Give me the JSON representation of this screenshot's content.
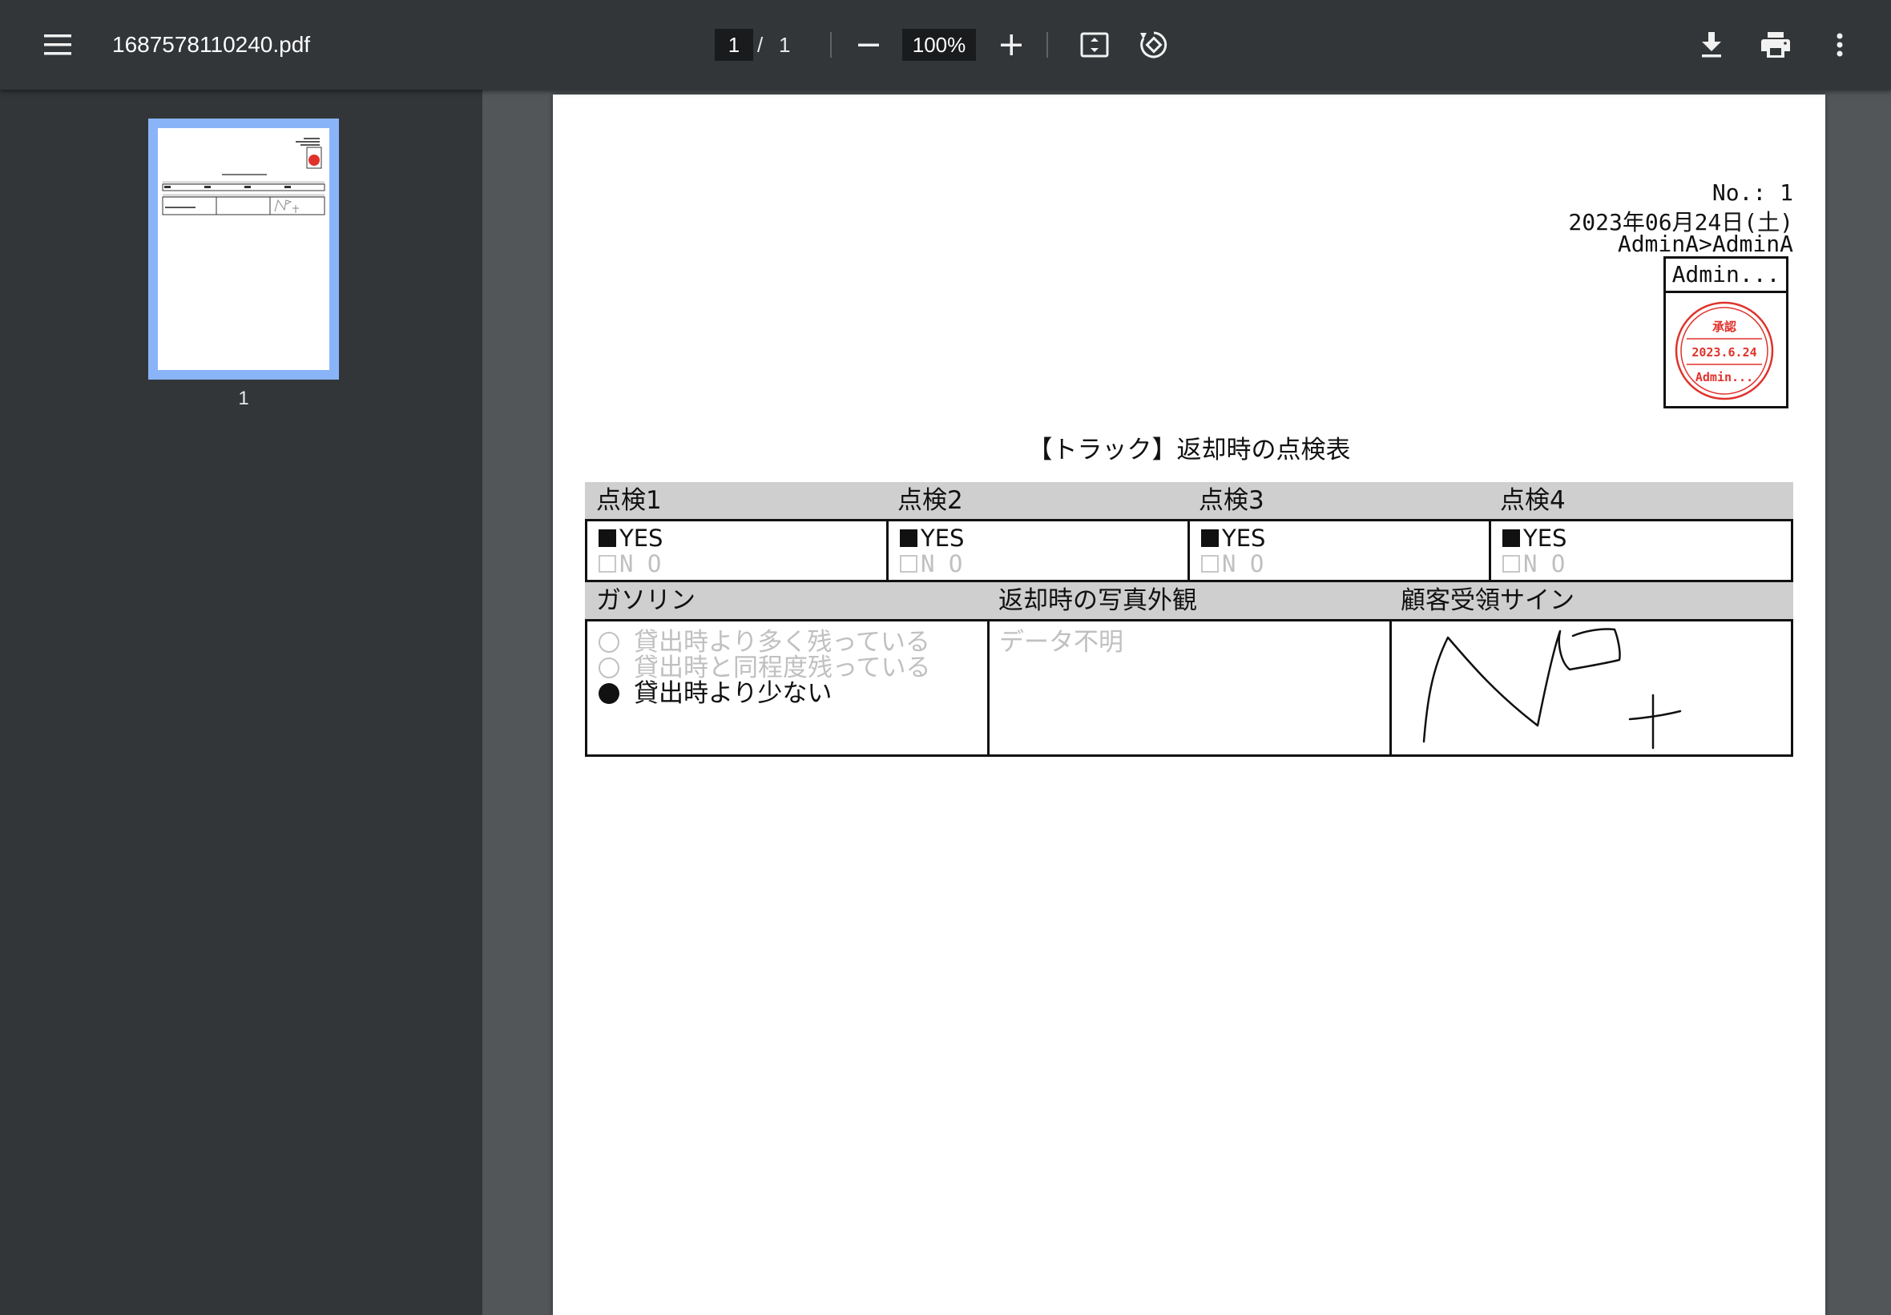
{
  "toolbar": {
    "file_name": "1687578110240.pdf",
    "page_current": "1",
    "page_separator": "/",
    "page_total": "1",
    "zoom": "100%"
  },
  "sidebar": {
    "thumbnails": [
      {
        "label": "1"
      }
    ]
  },
  "document": {
    "number": "No.: 1",
    "date": "2023年06月24日(土)",
    "route": "AdminA>AdminA",
    "stamp": {
      "name": "Admin...",
      "seal_title": "承認",
      "seal_date": "2023.6.24",
      "seal_name": "Admin...",
      "seal_color": "#e0322b"
    },
    "title": "【トラック】返却時の点検表",
    "inspections": [
      {
        "label": "点検1",
        "yes": "YES",
        "no": "N O",
        "selected": "yes"
      },
      {
        "label": "点検2",
        "yes": "YES",
        "no": "N O",
        "selected": "yes"
      },
      {
        "label": "点検3",
        "yes": "YES",
        "no": "N O",
        "selected": "yes"
      },
      {
        "label": "点検4",
        "yes": "YES",
        "no": "N O",
        "selected": "yes"
      }
    ],
    "gasoline": {
      "label": "ガソリン",
      "options": [
        {
          "text": "貸出時より多く残っている",
          "selected": false
        },
        {
          "text": "貸出時と同程度残っている",
          "selected": false
        },
        {
          "text": "貸出時より少ない",
          "selected": true
        }
      ]
    },
    "photo": {
      "label": "返却時の写真外観",
      "value": "データ不明"
    },
    "signature": {
      "label": "顧客受領サイン"
    }
  }
}
